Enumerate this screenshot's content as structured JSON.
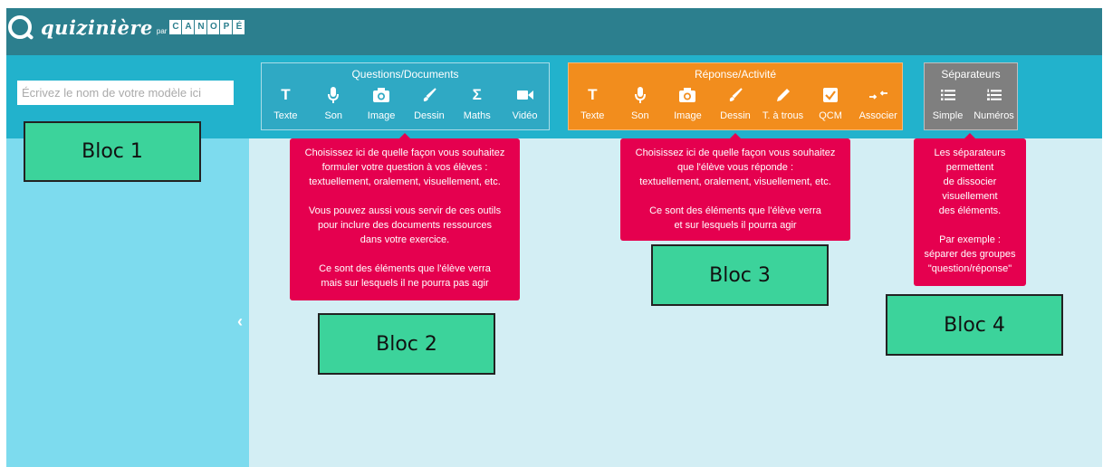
{
  "header": {
    "logo_text": "quizinière",
    "logo_par": "par",
    "canope_letters": [
      "C",
      "A",
      "N",
      "O",
      "P",
      "É"
    ]
  },
  "model_name": {
    "placeholder": "Écrivez le nom de votre modèle ici",
    "value": ""
  },
  "groups": {
    "questions": {
      "title": "Questions/Documents",
      "color": "#2fa9c4",
      "tools": [
        {
          "label": "Texte",
          "icon": "text-icon"
        },
        {
          "label": "Son",
          "icon": "microphone-icon"
        },
        {
          "label": "Image",
          "icon": "camera-icon"
        },
        {
          "label": "Dessin",
          "icon": "brush-icon"
        },
        {
          "label": "Maths",
          "icon": "sigma-icon"
        },
        {
          "label": "Vidéo",
          "icon": "video-camera-icon"
        }
      ],
      "tooltip": "Choisissez ici de quelle façon vous souhaitez\nformuler votre question à vos élèves :\ntextuellement, oralement, visuellement, etc.\n\nVous pouvez aussi vous servir de ces outils\npour inclure des documents ressources\ndans votre exercice.\n\nCe sont des éléments que l'élève verra\nmais sur lesquels il ne pourra pas agir"
    },
    "reponse": {
      "title": "Réponse/Activité",
      "color": "#f28d1d",
      "tools": [
        {
          "label": "Texte",
          "icon": "text-icon"
        },
        {
          "label": "Son",
          "icon": "microphone-icon"
        },
        {
          "label": "Image",
          "icon": "camera-icon"
        },
        {
          "label": "Dessin",
          "icon": "brush-icon"
        },
        {
          "label": "T. à trous",
          "icon": "pencil-icon"
        },
        {
          "label": "QCM",
          "icon": "checkbox-icon"
        },
        {
          "label": "Associer",
          "icon": "arrows-join-icon"
        }
      ],
      "tooltip": "Choisissez ici de quelle façon vous souhaitez\nque l'élève vous réponde :\ntextuellement, oralement, visuellement, etc.\n\nCe sont des éléments que l'élève verra\net sur lesquels il pourra agir"
    },
    "separateurs": {
      "title": "Séparateurs",
      "color": "#7f7f7f",
      "tools": [
        {
          "label": "Simple",
          "icon": "bullet-list-icon"
        },
        {
          "label": "Numéros",
          "icon": "numbered-list-icon"
        }
      ],
      "tooltip": "Les séparateurs\npermettent\nde dissocier\nvisuellement\ndes éléments.\n\nPar exemple :\nséparer des groupes\n\"question/réponse\""
    }
  },
  "blocs": [
    "Bloc 1",
    "Bloc 2",
    "Bloc 3",
    "Bloc 4"
  ],
  "sidebar": {
    "collapse_icon": "chevron-left-icon"
  },
  "colors": {
    "header": "#2c7f8e",
    "toolbar": "#22b2cc",
    "sidebar": "#7ddbee",
    "canvas": "#d3eef4",
    "tooltip": "#e5004f",
    "bloc": "#3cd39b"
  }
}
